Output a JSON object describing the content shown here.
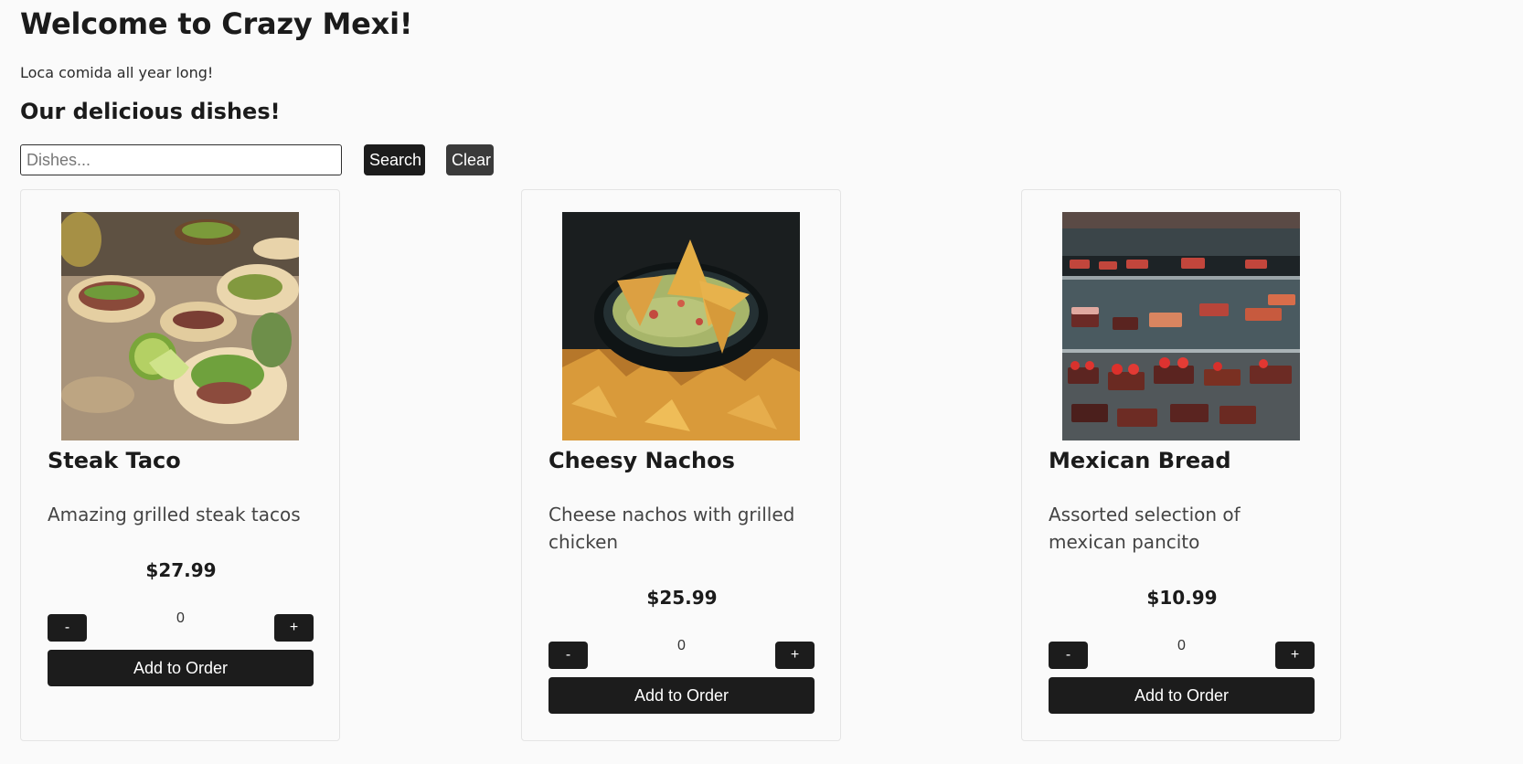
{
  "header": {
    "title": "Welcome to Crazy Mexi!",
    "tagline": "Loca comida all year long!",
    "section_title": "Our delicious dishes!"
  },
  "search": {
    "placeholder": "Dishes...",
    "value": "",
    "search_label": "Search",
    "clear_label": "Clear"
  },
  "dishes": [
    {
      "name": "Steak Taco",
      "description": "Amazing grilled steak tacos",
      "price": "$27.99",
      "quantity": "0",
      "minus_label": "-",
      "plus_label": "+",
      "add_label": "Add to Order",
      "image": "steak-tacos-photo"
    },
    {
      "name": "Cheesy Nachos",
      "description": "Cheese nachos with grilled chicken",
      "price": "$25.99",
      "quantity": "0",
      "minus_label": "-",
      "plus_label": "+",
      "add_label": "Add to Order",
      "image": "nachos-guacamole-photo"
    },
    {
      "name": "Mexican Bread",
      "description": "Assorted selection of mexican pancito",
      "price": "$10.99",
      "quantity": "0",
      "minus_label": "-",
      "plus_label": "+",
      "add_label": "Add to Order",
      "image": "pastry-display-case-photo"
    }
  ],
  "colors": {
    "background": "#fafafa",
    "button": "#1c1c1c",
    "clear_button": "#3a3a3a",
    "text": "#1b1b1b"
  }
}
